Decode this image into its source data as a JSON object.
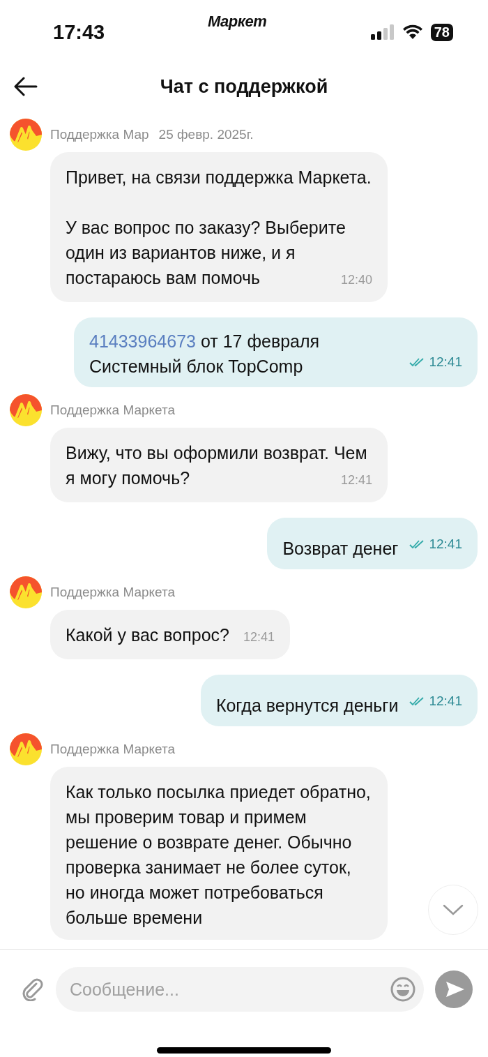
{
  "status_bar": {
    "time": "17:43",
    "app_name": "Маркет",
    "battery": "78"
  },
  "header": {
    "title": "Чат с поддержкой"
  },
  "messages": [
    {
      "kind": "incoming",
      "sender": "Поддержка Мар",
      "date": "25 февр. 2025г.",
      "paragraphs": [
        "Привет, на связи поддержка Маркета.",
        "У вас вопрос по заказу? Выберите один из вариантов ниже, и я постараюсь вам помочь"
      ],
      "time": "12:40"
    },
    {
      "kind": "outgoing",
      "link": "41433964673",
      "text": "от 17 февраля Системный блок TopComp",
      "time": "12:41",
      "read": true
    },
    {
      "kind": "incoming",
      "sender": "Поддержка Маркета",
      "paragraphs": [
        "Вижу, что вы оформили возврат. Чем я могу помочь?"
      ],
      "time": "12:41"
    },
    {
      "kind": "outgoing",
      "text": "Возврат денег",
      "time": "12:41",
      "read": true
    },
    {
      "kind": "incoming",
      "sender": "Поддержка Маркета",
      "paragraphs": [
        "Какой у вас вопрос?"
      ],
      "time": "12:41"
    },
    {
      "kind": "outgoing",
      "text": "Когда вернутся деньги",
      "time": "12:41",
      "read": true
    },
    {
      "kind": "incoming",
      "sender": "Поддержка Маркета",
      "paragraphs": [
        "Как только посылка приедет обратно, мы проверим товар и примем решение о возврате денег. Обычно проверка занимает не более суток, но иногда может потребоваться больше времени"
      ]
    }
  ],
  "composer": {
    "placeholder": "Сообщение..."
  }
}
